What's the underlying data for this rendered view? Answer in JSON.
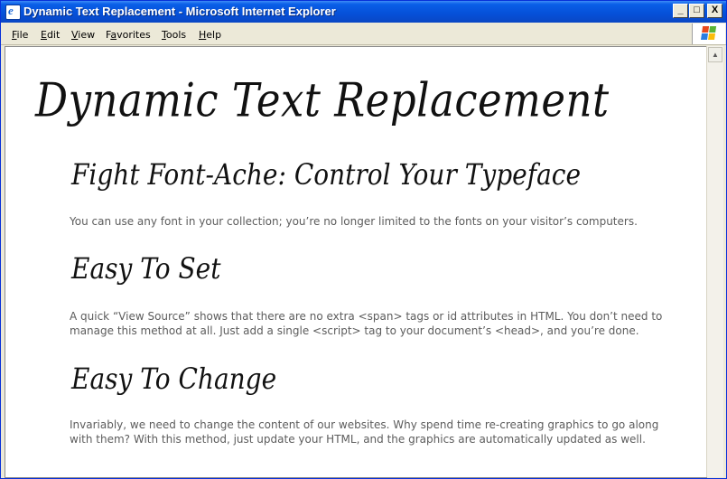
{
  "window": {
    "title": "Dynamic Text Replacement - Microsoft Internet Explorer",
    "controls": {
      "minimize": "_",
      "maximize": "□",
      "close": "X"
    }
  },
  "menu": [
    {
      "label": "File",
      "accel": "F",
      "rest": "ile"
    },
    {
      "label": "Edit",
      "accel": "E",
      "rest": "dit"
    },
    {
      "label": "View",
      "accel": "V",
      "rest": "iew"
    },
    {
      "label": "Favorites",
      "accel": "F",
      "rest": "a vorites"
    },
    {
      "label": "Tools",
      "accel": "T",
      "rest": "ools"
    },
    {
      "label": "Help",
      "accel": "H",
      "rest": "elp"
    }
  ],
  "page": {
    "heading": "Dynamic Text Replacement",
    "sections": [
      {
        "title": "Fight Font-Ache: Control Your Typeface",
        "body": "You can use any font in your collection; you’re no longer limited to the fonts on your visitor’s computers."
      },
      {
        "title": "Easy To Set",
        "body": "A quick “View Source” shows that there are no extra <span> tags or id attributes in HTML. You don’t need to manage this method at all. Just add a single <script> tag to your document’s <head>, and you’re done."
      },
      {
        "title": "Easy To Change",
        "body": "Invariably, we need to change the content of our websites. Why spend time re-creating graphics to go along with them? With this method, just update your HTML, and the graphics are automatically updated as well."
      }
    ]
  },
  "icons": {
    "app": "internet-explorer-icon",
    "throbber": "windows-logo-icon",
    "scroll_up": "scroll-up-arrow-icon"
  },
  "colors": {
    "titlebar": "#0a5fe8",
    "body_text": "#5c5c5c",
    "heading_text": "#111111"
  }
}
